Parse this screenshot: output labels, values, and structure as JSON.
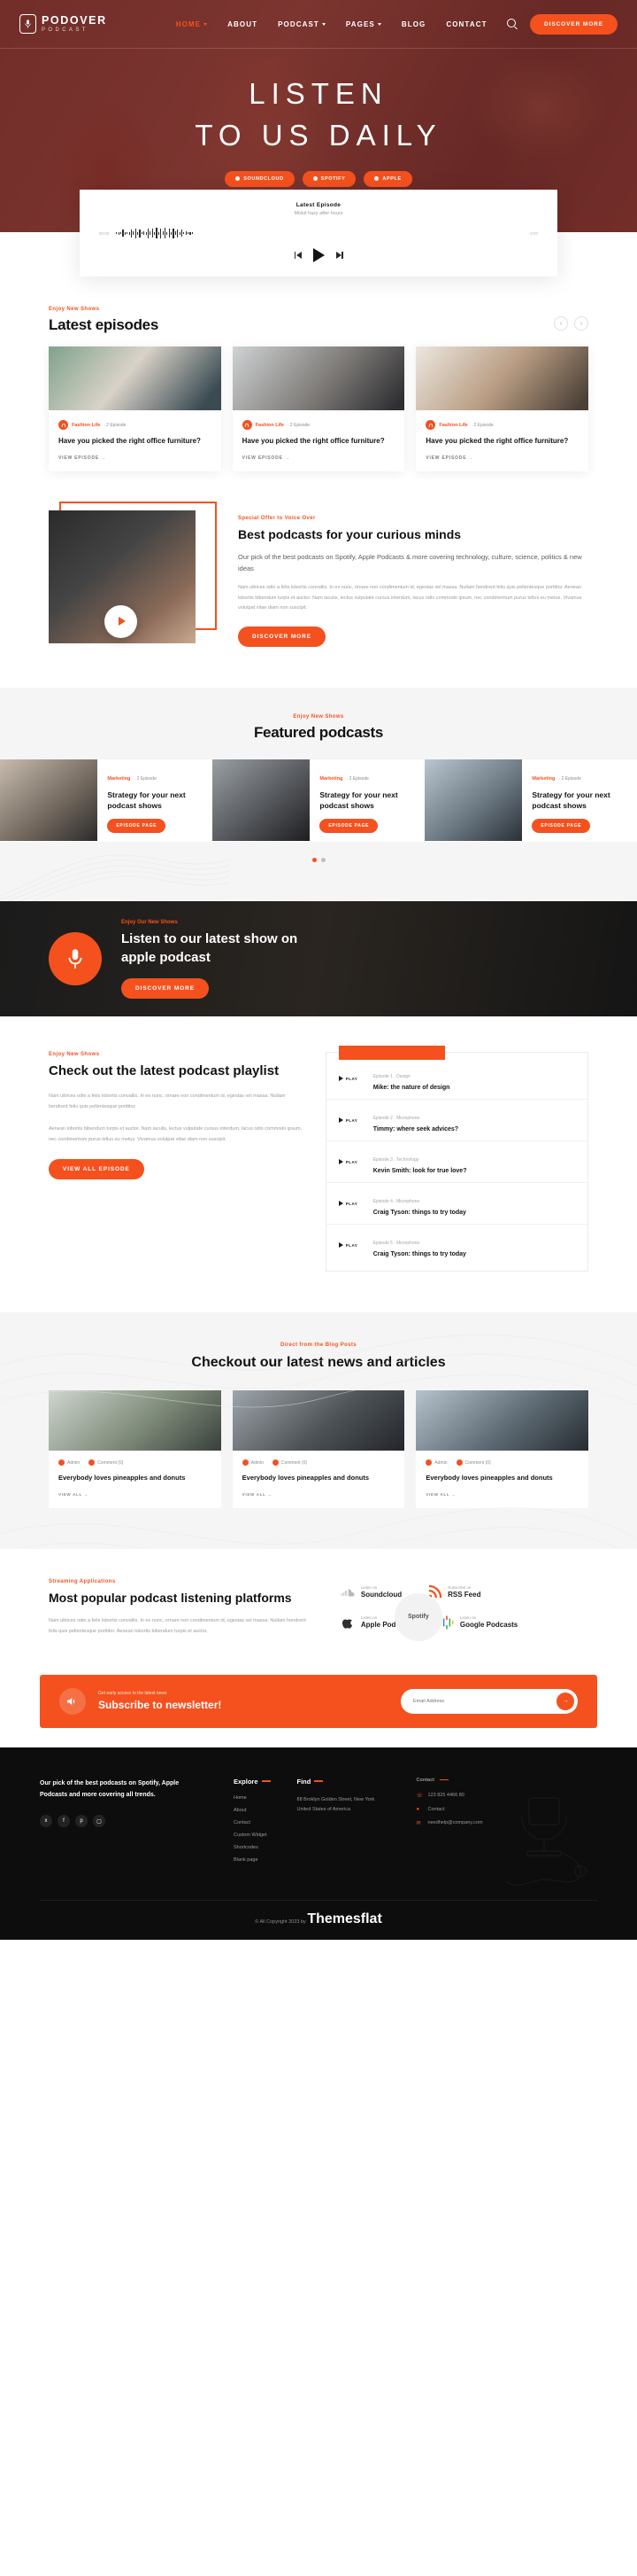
{
  "brand": {
    "name": "PODOVER",
    "sub": "PODCAST"
  },
  "nav": {
    "items": [
      {
        "label": "HOME",
        "caret": true,
        "active": true
      },
      {
        "label": "ABOUT",
        "caret": false,
        "active": false
      },
      {
        "label": "PODCAST",
        "caret": true,
        "active": false
      },
      {
        "label": "PAGES",
        "caret": true,
        "active": false
      },
      {
        "label": "BLOG",
        "caret": false,
        "active": false
      },
      {
        "label": "CONTACT",
        "caret": false,
        "active": false
      }
    ],
    "search_icon": "search-icon",
    "cta": "DISCOVER MORE"
  },
  "hero": {
    "title_line1": "LISTEN",
    "title_line2": "TO US DAILY",
    "badges": [
      "SOUNDCLOUD",
      "SPOTIFY",
      "APPLE"
    ]
  },
  "player": {
    "title": "Latest Episode",
    "subtitle": "Mixkit hazy after hours",
    "current_time": "00:00",
    "duration": "-3:07"
  },
  "latest": {
    "eyebrow": "Enjoy New Shows",
    "title": "Latest episodes",
    "prev": "‹",
    "next": "›",
    "cards": [
      {
        "category": "Fashion Life",
        "count": ". 2 Episode",
        "title": "Have you picked the right office furniture?",
        "link": "VIEW EPISODE →"
      },
      {
        "category": "Fashion Life",
        "count": ". 2 Episode",
        "title": "Have you picked the right office furniture?",
        "link": "VIEW EPISODE →"
      },
      {
        "category": "Fashion Life",
        "count": ". 2 Episode",
        "title": "Have you picked the right office furniture?",
        "link": "VIEW EPISODE →"
      }
    ]
  },
  "best": {
    "eyebrow": "Special Offer to Voice Over",
    "title": "Best podcasts for your curious minds",
    "lead": "Our pick of the best podcasts on Spotify, Apple Podcasts & more covering technology, culture, science, politics & new ideas",
    "body": "Nam ultrices odio a felis lobortis convallis. In ex nunc, ornare non condimentum id, egestas vel massa. Nullam hendrerit felis quis pellentesque porttitor. Aenean lobortis bibendum turpis et auctor. Nam iaculis, lectus vulputate cursus interdum, lacus odio commodo ipsum, nec condimentum purus tellus eu metus. Vivamus volutpat vitae diam non suscipit.",
    "button": "DISCOVER MORE"
  },
  "featured": {
    "eyebrow": "Enjoy New Shows",
    "title": "Featured podcasts",
    "cards": [
      {
        "category": "Marketing",
        "count": ". 2 Episode",
        "title": "Strategy for your next podcast shows",
        "button": "EPISODE PAGE"
      },
      {
        "category": "Marketing",
        "count": ". 2 Episode",
        "title": "Strategy for your next podcast shows",
        "button": "EPISODE PAGE"
      },
      {
        "category": "Marketing",
        "count": ". 2 Episode",
        "title": "Strategy for your next podcast shows",
        "button": "EPISODE PAGE"
      }
    ],
    "dots": 2
  },
  "cta": {
    "eyebrow": "Enjoy Our New Shows",
    "title": "Listen to our latest show on apple podcast",
    "button": "DISCOVER MORE"
  },
  "playlist": {
    "eyebrow": "Enjoy New Shows",
    "title": "Check out the latest podcast playlist",
    "p1": "Nam ultrices odio a felis lobortis convallis. In ex nunc, ornare non condimentum id, egestas vel massa. Nullam hendrerit felis quis pellentesque porttitor.",
    "p2": "Aenean lobortis bibendum turpis et auctor. Nam iaculis, lectus vulputate cursus interdum, lacus odio commodo ipsum, nec condimentum purus tellus eu metus. Vivamus volutpat vitae diam non suscipit.",
    "button": "VIEW ALL EPISODE",
    "play_label": "PLAY",
    "items": [
      {
        "meta": "Episode 1 . Design",
        "name": "Mike: the nature of design"
      },
      {
        "meta": "Episode 2 . Microphone",
        "name": "Timmy: where seek advices?"
      },
      {
        "meta": "Episode 3 . Technology",
        "name": "Kevin Smith: look for true love?"
      },
      {
        "meta": "Episode 4 . Microphone",
        "name": "Craig Tyson: things to try today"
      },
      {
        "meta": "Episode 5 . Microphone",
        "name": "Craig Tyson: things to try today"
      }
    ]
  },
  "news": {
    "eyebrow": "Direct from the Blog Posts",
    "title": "Checkout our latest news and articles",
    "cards": [
      {
        "admin": "Admin",
        "comments": "Comment (0)",
        "title": "Everybody loves pineapples and donuts",
        "link": "VIEW ALL →"
      },
      {
        "admin": "Admin",
        "comments": "Comment (0)",
        "title": "Everybody loves pineapples and donuts",
        "link": "VIEW ALL →"
      },
      {
        "admin": "Admin",
        "comments": "Comment (0)",
        "title": "Everybody loves pineapples and donuts",
        "link": "VIEW ALL →"
      }
    ]
  },
  "platforms": {
    "eyebrow": "Streaming Applications",
    "title": "Most popular podcast listening platforms",
    "body": "Nam ultrices odio a felis lobortis convallis. In ex nunc, ornare non condimentum id, egestas vel massa. Nullam hendrerit felis quis pellentesque porttitor. Aenean lobortis bibendum turpis et auctor.",
    "items": [
      {
        "sub": "Listen on",
        "name": "Soundcloud",
        "icon": "soundcloud-icon"
      },
      {
        "sub": "Subscribe on",
        "name": "RSS Feed",
        "icon": "rss-icon"
      },
      {
        "sub": "Listen on",
        "name": "Apple Podcasts",
        "icon": "apple-icon"
      },
      {
        "sub": "Listen on",
        "name": "Google Podcasts",
        "icon": "google-icon"
      }
    ],
    "spotify": "Spotify"
  },
  "newsletter": {
    "small": "Get early access to the latest news",
    "big": "Subscribe to newsletter!",
    "placeholder": "Email Address",
    "submit": "→"
  },
  "footer": {
    "about": "Our pick of the best podcasts on Spotify, Apple Podcasts and more covering all trends.",
    "social": [
      "twitter-icon",
      "facebook-icon",
      "pinterest-icon",
      "instagram-icon"
    ],
    "explore": {
      "title": "Explore",
      "links": [
        "Home",
        "About",
        "Contact",
        "Custom Widget",
        "Shortcodes",
        "Blank page"
      ]
    },
    "find": {
      "title": "Find",
      "address": "88 Broklyn Golden Street, New York United States of America"
    },
    "contact": {
      "title": "Contact",
      "phone": "123 825 4466 80",
      "link": "Contact",
      "email": "needhelp@company.com"
    },
    "copyright_pre": "© All Copyright 2023 by ",
    "copyright_brand": "Themesflat"
  }
}
